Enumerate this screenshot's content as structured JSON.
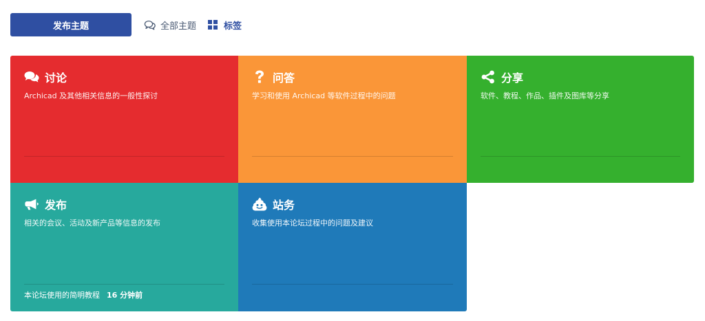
{
  "toolbar": {
    "new_topic_label": "发布主题",
    "all_topics_label": "全部主题",
    "tags_label": "标签"
  },
  "categories": [
    {
      "title": "讨论",
      "description": "Archicad 及其他相关信息的一般性探讨",
      "icon": "comments-icon",
      "color": "#e52c2f"
    },
    {
      "title": "问答",
      "description": "学习和使用 Archicad 等软件过程中的问题",
      "icon": "question-icon",
      "color": "#fa9638"
    },
    {
      "title": "分享",
      "description": "软件、教程、作品、插件及图库等分享",
      "icon": "share-icon",
      "color": "#35b02e"
    },
    {
      "title": "发布",
      "description": "相关的会议、活动及新产品等信息的发布",
      "icon": "bullhorn-icon",
      "color": "#27a99d",
      "last_post": {
        "title": "本论坛使用的简明教程",
        "time": "16 分钟前"
      }
    },
    {
      "title": "站务",
      "description": "收集使用本论坛过程中的问题及建议",
      "icon": "poop-icon",
      "color": "#1f7ab9"
    }
  ]
}
